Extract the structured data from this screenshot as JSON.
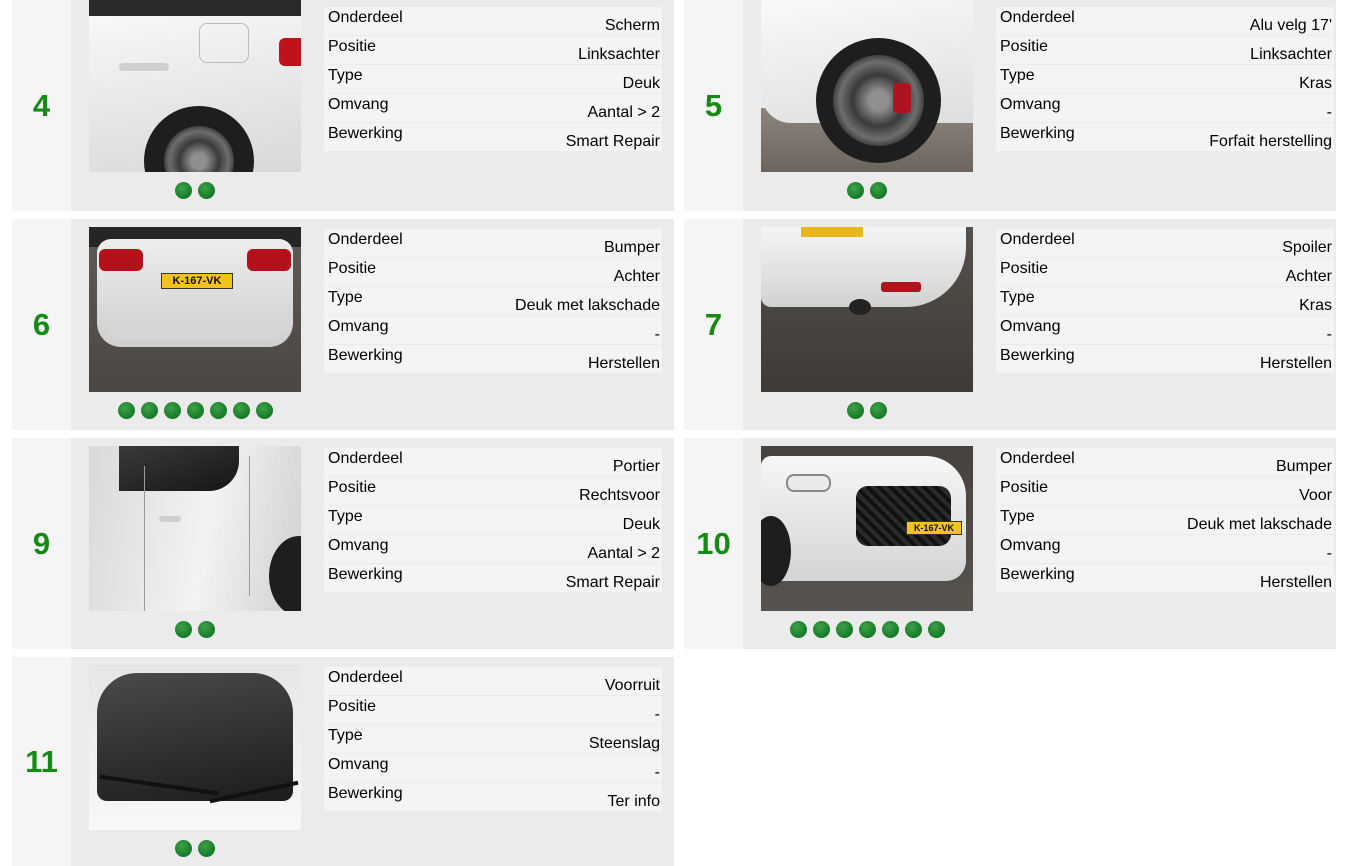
{
  "cards": [
    {
      "number": "4",
      "dot_count": 2,
      "rows": [
        {
          "label": "Onderdeel",
          "value": "Scherm"
        },
        {
          "label": "Positie",
          "value": "Linksachter"
        },
        {
          "label": "Type",
          "value": "Deuk"
        },
        {
          "label": "Omvang",
          "value": "Aantal > 2"
        },
        {
          "label": "Bewerking",
          "value": "Smart Repair"
        }
      ]
    },
    {
      "number": "5",
      "dot_count": 2,
      "rows": [
        {
          "label": "Onderdeel",
          "value": "Alu velg 17'"
        },
        {
          "label": "Positie",
          "value": "Linksachter"
        },
        {
          "label": "Type",
          "value": "Kras"
        },
        {
          "label": "Omvang",
          "value": "-"
        },
        {
          "label": "Bewerking",
          "value": "Forfait herstelling"
        }
      ]
    },
    {
      "number": "6",
      "dot_count": 7,
      "plate": "K-167-VK",
      "rows": [
        {
          "label": "Onderdeel",
          "value": "Bumper"
        },
        {
          "label": "Positie",
          "value": "Achter"
        },
        {
          "label": "Type",
          "value": "Deuk met lakschade"
        },
        {
          "label": "Omvang",
          "value": "-"
        },
        {
          "label": "Bewerking",
          "value": "Herstellen"
        }
      ]
    },
    {
      "number": "7",
      "dot_count": 2,
      "rows": [
        {
          "label": "Onderdeel",
          "value": "Spoiler"
        },
        {
          "label": "Positie",
          "value": "Achter"
        },
        {
          "label": "Type",
          "value": "Kras"
        },
        {
          "label": "Omvang",
          "value": "-"
        },
        {
          "label": "Bewerking",
          "value": "Herstellen"
        }
      ]
    },
    {
      "number": "9",
      "dot_count": 2,
      "rows": [
        {
          "label": "Onderdeel",
          "value": "Portier"
        },
        {
          "label": "Positie",
          "value": "Rechtsvoor"
        },
        {
          "label": "Type",
          "value": "Deuk"
        },
        {
          "label": "Omvang",
          "value": "Aantal > 2"
        },
        {
          "label": "Bewerking",
          "value": "Smart Repair"
        }
      ]
    },
    {
      "number": "10",
      "dot_count": 7,
      "plate": "K-167-VK",
      "rows": [
        {
          "label": "Onderdeel",
          "value": "Bumper"
        },
        {
          "label": "Positie",
          "value": "Voor"
        },
        {
          "label": "Type",
          "value": "Deuk met lakschade"
        },
        {
          "label": "Omvang",
          "value": "-"
        },
        {
          "label": "Bewerking",
          "value": "Herstellen"
        }
      ]
    },
    {
      "number": "11",
      "dot_count": 2,
      "rows": [
        {
          "label": "Onderdeel",
          "value": "Voorruit"
        },
        {
          "label": "Positie",
          "value": "-"
        },
        {
          "label": "Type",
          "value": "Steenslag"
        },
        {
          "label": "Omvang",
          "value": "-"
        },
        {
          "label": "Bewerking",
          "value": "Ter info"
        }
      ]
    }
  ],
  "colors": {
    "number": "#148c14",
    "dot": "#1f8a2e",
    "card_bg": "#ebebeb",
    "row_bg": "#f4f4f4"
  }
}
